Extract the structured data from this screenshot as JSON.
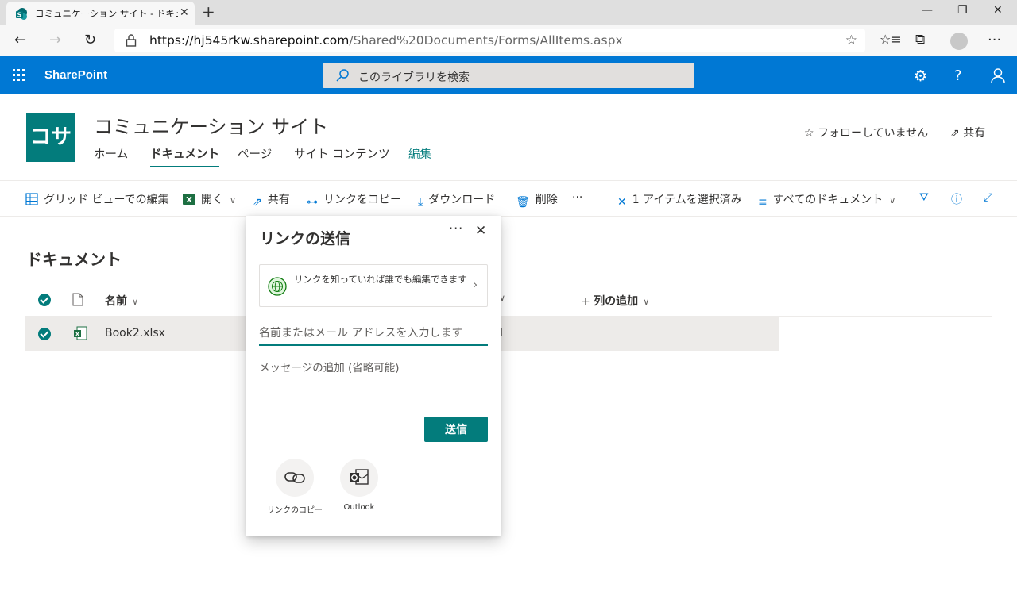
{
  "browser": {
    "tab_title": "コミュニケーション サイト - ドキュメント",
    "url_host": "https://hj545rkw.sharepoint.com",
    "url_path": "/Shared%20Documents/Forms/AllItems.aspx"
  },
  "suite": {
    "brand": "SharePoint",
    "search_placeholder": "このライブラリを検索"
  },
  "site": {
    "logo_text": "コサ",
    "title": "コミュニケーション サイト",
    "nav": [
      "ホーム",
      "ドキュメント",
      "ページ",
      "サイト コンテンツ",
      "編集"
    ],
    "follow_label": "フォローしていません",
    "share_label": "共有"
  },
  "commands": {
    "grid_edit": "グリッド ビューでの編集",
    "open": "開く",
    "share": "共有",
    "copy_link": "リンクをコピー",
    "download": "ダウンロード",
    "delete": "削除",
    "more": "···",
    "selected": "1 アイテムを選択済み",
    "view": "すべてのドキュメント"
  },
  "library": {
    "title": "ドキュメント",
    "col_name": "名前",
    "col_add": "列の追加",
    "rows": [
      {
        "name": "Book2.xlsx",
        "partial": "d"
      }
    ]
  },
  "share_dialog": {
    "title": "リンクの送信",
    "link_setting": "リンクを知っていれば誰でも編集できます",
    "name_placeholder": "名前またはメール アドレスを入力します",
    "message_placeholder": "メッセージの追加 (省略可能)",
    "send_label": "送信",
    "options": [
      "リンクのコピー",
      "Outlook"
    ]
  },
  "colors": {
    "suite_blue": "#0078d4",
    "teal": "#037c7c"
  }
}
